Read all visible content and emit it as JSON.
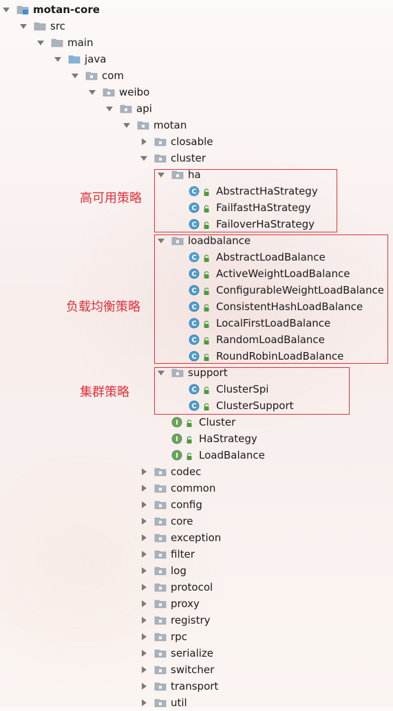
{
  "tree": [
    {
      "label": "motan-core",
      "depth": 0,
      "kind": "module",
      "arrow": "down",
      "bold": true
    },
    {
      "label": "src",
      "depth": 1,
      "kind": "folder",
      "arrow": "down"
    },
    {
      "label": "main",
      "depth": 2,
      "kind": "folder",
      "arrow": "down"
    },
    {
      "label": "java",
      "depth": 3,
      "kind": "source-folder",
      "arrow": "down"
    },
    {
      "label": "com",
      "depth": 4,
      "kind": "package",
      "arrow": "down"
    },
    {
      "label": "weibo",
      "depth": 5,
      "kind": "package",
      "arrow": "down"
    },
    {
      "label": "api",
      "depth": 6,
      "kind": "package",
      "arrow": "down"
    },
    {
      "label": "motan",
      "depth": 7,
      "kind": "package",
      "arrow": "down"
    },
    {
      "label": "closable",
      "depth": 8,
      "kind": "package",
      "arrow": "right"
    },
    {
      "label": "cluster",
      "depth": 8,
      "kind": "package",
      "arrow": "down"
    },
    {
      "label": "ha",
      "depth": 9,
      "kind": "package",
      "arrow": "down"
    },
    {
      "label": "AbstractHaStrategy",
      "depth": 10,
      "kind": "abstract-class",
      "arrow": "none"
    },
    {
      "label": "FailfastHaStrategy",
      "depth": 10,
      "kind": "class",
      "arrow": "none"
    },
    {
      "label": "FailoverHaStrategy",
      "depth": 10,
      "kind": "class",
      "arrow": "none"
    },
    {
      "label": "loadbalance",
      "depth": 9,
      "kind": "package",
      "arrow": "down"
    },
    {
      "label": "AbstractLoadBalance",
      "depth": 10,
      "kind": "abstract-class",
      "arrow": "none"
    },
    {
      "label": "ActiveWeightLoadBalance",
      "depth": 10,
      "kind": "class",
      "arrow": "none"
    },
    {
      "label": "ConfigurableWeightLoadBalance",
      "depth": 10,
      "kind": "class",
      "arrow": "none"
    },
    {
      "label": "ConsistentHashLoadBalance",
      "depth": 10,
      "kind": "class",
      "arrow": "none"
    },
    {
      "label": "LocalFirstLoadBalance",
      "depth": 10,
      "kind": "class",
      "arrow": "none"
    },
    {
      "label": "RandomLoadBalance",
      "depth": 10,
      "kind": "class",
      "arrow": "none"
    },
    {
      "label": "RoundRobinLoadBalance",
      "depth": 10,
      "kind": "class",
      "arrow": "none"
    },
    {
      "label": "support",
      "depth": 9,
      "kind": "package",
      "arrow": "down"
    },
    {
      "label": "ClusterSpi",
      "depth": 10,
      "kind": "class",
      "arrow": "none"
    },
    {
      "label": "ClusterSupport",
      "depth": 10,
      "kind": "class",
      "arrow": "none"
    },
    {
      "label": "Cluster",
      "depth": 9,
      "kind": "interface",
      "arrow": "none"
    },
    {
      "label": "HaStrategy",
      "depth": 9,
      "kind": "interface",
      "arrow": "none"
    },
    {
      "label": "LoadBalance",
      "depth": 9,
      "kind": "interface",
      "arrow": "none"
    },
    {
      "label": "codec",
      "depth": 8,
      "kind": "package",
      "arrow": "right"
    },
    {
      "label": "common",
      "depth": 8,
      "kind": "package",
      "arrow": "right"
    },
    {
      "label": "config",
      "depth": 8,
      "kind": "package",
      "arrow": "right"
    },
    {
      "label": "core",
      "depth": 8,
      "kind": "package",
      "arrow": "right"
    },
    {
      "label": "exception",
      "depth": 8,
      "kind": "package",
      "arrow": "right"
    },
    {
      "label": "filter",
      "depth": 8,
      "kind": "package",
      "arrow": "right"
    },
    {
      "label": "log",
      "depth": 8,
      "kind": "package",
      "arrow": "right"
    },
    {
      "label": "protocol",
      "depth": 8,
      "kind": "package",
      "arrow": "right"
    },
    {
      "label": "proxy",
      "depth": 8,
      "kind": "package",
      "arrow": "right"
    },
    {
      "label": "registry",
      "depth": 8,
      "kind": "package",
      "arrow": "right"
    },
    {
      "label": "rpc",
      "depth": 8,
      "kind": "package",
      "arrow": "right"
    },
    {
      "label": "serialize",
      "depth": 8,
      "kind": "package",
      "arrow": "right"
    },
    {
      "label": "switcher",
      "depth": 8,
      "kind": "package",
      "arrow": "right"
    },
    {
      "label": "transport",
      "depth": 8,
      "kind": "package",
      "arrow": "right"
    },
    {
      "label": "util",
      "depth": 8,
      "kind": "package",
      "arrow": "right"
    }
  ],
  "annotations": [
    {
      "text": "高可用策略",
      "group": "ha"
    },
    {
      "text": "负载均衡策略",
      "group": "loadbalance"
    },
    {
      "text": "集群策略",
      "group": "support"
    }
  ],
  "colors": {
    "annotation": "#e0303a",
    "folder": "#a9b3bd",
    "source_folder": "#7fb3dc",
    "class_icon": "#4a9fd4",
    "interface_icon": "#6aaa4a",
    "arrow": "#7a7a7a",
    "lock": "#4c9a3c"
  }
}
